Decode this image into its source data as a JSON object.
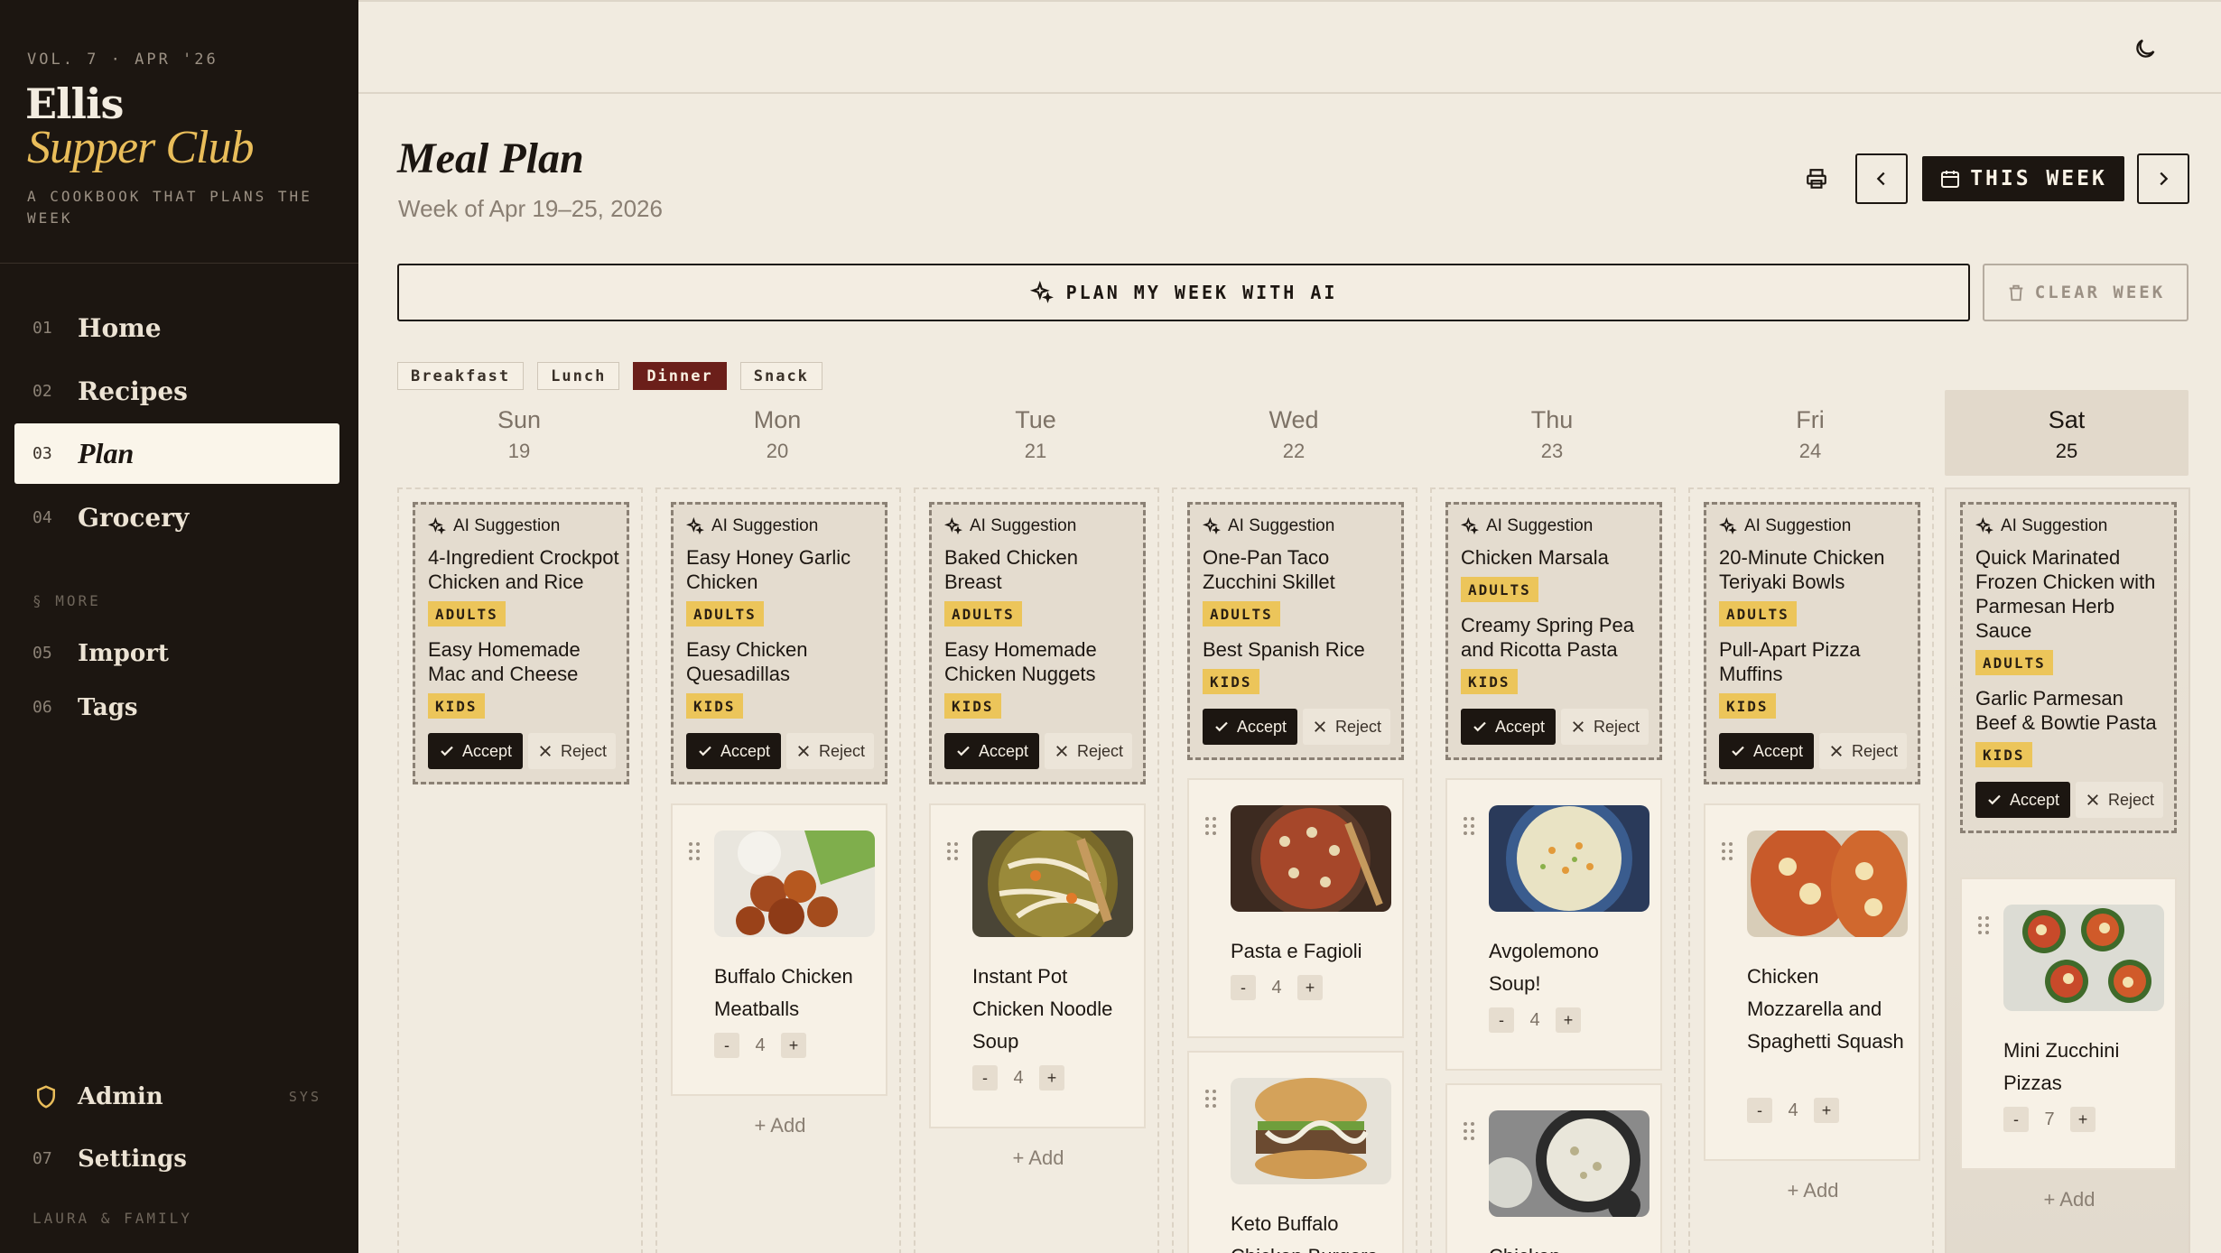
{
  "sidebar": {
    "volume": "VOL. 7 · APR '26",
    "brand_line1": "Ellis",
    "brand_line2": "Supper Club",
    "tagline": "A COOKBOOK THAT PLANS THE WEEK",
    "nav": [
      {
        "num": "01",
        "label": "Home"
      },
      {
        "num": "02",
        "label": "Recipes"
      },
      {
        "num": "03",
        "label": "Plan"
      },
      {
        "num": "04",
        "label": "Grocery"
      }
    ],
    "more_label": "§ MORE",
    "more": [
      {
        "num": "05",
        "label": "Import"
      },
      {
        "num": "06",
        "label": "Tags"
      }
    ],
    "admin_label": "Admin",
    "admin_badge": "SYS",
    "settings": {
      "num": "07",
      "label": "Settings"
    },
    "footer_user": "LAURA & FAMILY"
  },
  "header": {
    "title": "Meal Plan",
    "subtitle": "Week of Apr 19–25, 2026",
    "this_week_label": "THIS WEEK",
    "ai_plan_label": "PLAN MY WEEK WITH AI",
    "clear_week_label": "CLEAR WEEK"
  },
  "filters": [
    "Breakfast",
    "Lunch",
    "Dinner",
    "Snack"
  ],
  "active_filter": "Dinner",
  "ai_label": "AI Suggestion",
  "accept_label": "Accept",
  "reject_label": "Reject",
  "add_label": "+ Add",
  "days": [
    {
      "name": "Sun",
      "date": "19",
      "today": false,
      "suggestion": {
        "items": [
          {
            "title": "4-Ingredient Crockpot Chicken and Rice",
            "tag": "ADULTS"
          },
          {
            "title": "Easy Homemade Mac and Cheese",
            "tag": "KIDS"
          }
        ]
      },
      "meals": []
    },
    {
      "name": "Mon",
      "date": "20",
      "today": false,
      "suggestion": {
        "items": [
          {
            "title": "Easy Honey Garlic Chicken",
            "tag": "ADULTS"
          },
          {
            "title": "Easy Chicken Quesadillas",
            "tag": "KIDS"
          }
        ]
      },
      "meals": [
        {
          "name": "Buffalo Chicken Meatballs",
          "servings": "4"
        }
      ]
    },
    {
      "name": "Tue",
      "date": "21",
      "today": false,
      "suggestion": {
        "items": [
          {
            "title": "Baked Chicken Breast",
            "tag": "ADULTS"
          },
          {
            "title": "Easy Homemade Chicken Nuggets",
            "tag": "KIDS"
          }
        ]
      },
      "meals": [
        {
          "name": "Instant Pot Chicken Noodle Soup",
          "servings": "4"
        }
      ]
    },
    {
      "name": "Wed",
      "date": "22",
      "today": false,
      "suggestion": {
        "items": [
          {
            "title": "One-Pan Taco Zucchini Skillet",
            "tag": "ADULTS"
          },
          {
            "title": "Best Spanish Rice",
            "tag": "KIDS"
          }
        ]
      },
      "meals": [
        {
          "name": "Pasta e Fagioli",
          "servings": "4"
        },
        {
          "name": "Keto Buffalo Chicken Burgers",
          "servings": ""
        }
      ]
    },
    {
      "name": "Thu",
      "date": "23",
      "today": false,
      "suggestion": {
        "items": [
          {
            "title": "Chicken Marsala",
            "tag": "ADULTS"
          },
          {
            "title": "Creamy Spring Pea and Ricotta Pasta",
            "tag": "KIDS"
          }
        ]
      },
      "meals": [
        {
          "name": "Avgolemono Soup!",
          "servings": "4"
        },
        {
          "name": "Chicken",
          "servings": ""
        }
      ]
    },
    {
      "name": "Fri",
      "date": "24",
      "today": false,
      "suggestion": {
        "items": [
          {
            "title": "20-Minute Chicken Teriyaki Bowls",
            "tag": "ADULTS"
          },
          {
            "title": "Pull-Apart Pizza Muffins",
            "tag": "KIDS"
          }
        ]
      },
      "meals": [
        {
          "name": "Chicken Mozzarella and Spaghetti Squash",
          "servings": "4"
        }
      ]
    },
    {
      "name": "Sat",
      "date": "25",
      "today": true,
      "suggestion": {
        "items": [
          {
            "title": "Quick Marinated Frozen Chicken with Parmesan Herb Sauce",
            "tag": "ADULTS"
          },
          {
            "title": "Garlic Parmesan Beef & Bowtie Pasta",
            "tag": "KIDS"
          }
        ]
      },
      "meals": [
        {
          "name": "Mini Zucchini Pizzas",
          "servings": "7"
        }
      ]
    }
  ]
}
